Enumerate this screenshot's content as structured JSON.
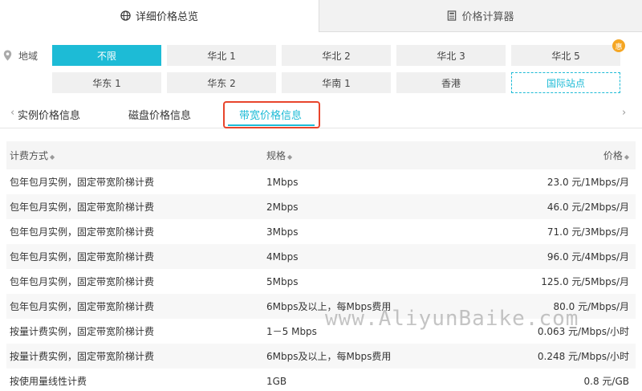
{
  "top_tabs": [
    {
      "label": "详细价格总览",
      "icon": "globe-icon",
      "active": true
    },
    {
      "label": "价格计算器",
      "icon": "calculator-icon",
      "active": false
    }
  ],
  "region": {
    "label": "地域",
    "icon": "location-pin-icon",
    "buttons_row1": [
      "不限",
      "华北 1",
      "华北 2",
      "华北 3",
      "华北 5"
    ],
    "buttons_row2": [
      "华东 1",
      "华东 2",
      "华南 1",
      "香港",
      "国际站点"
    ],
    "selected": "不限",
    "badge": "惠"
  },
  "sub_tabs": [
    "实例价格信息",
    "磁盘价格信息",
    "带宽价格信息"
  ],
  "active_sub_tab": "带宽价格信息",
  "table": {
    "headers": [
      "计费方式",
      "规格",
      "价格"
    ],
    "rows": [
      [
        "包年包月实例，固定带宽阶梯计费",
        "1Mbps",
        "23.0 元/1Mbps/月"
      ],
      [
        "包年包月实例，固定带宽阶梯计费",
        "2Mbps",
        "46.0 元/2Mbps/月"
      ],
      [
        "包年包月实例，固定带宽阶梯计费",
        "3Mbps",
        "71.0 元/3Mbps/月"
      ],
      [
        "包年包月实例，固定带宽阶梯计费",
        "4Mbps",
        "96.0 元/4Mbps/月"
      ],
      [
        "包年包月实例，固定带宽阶梯计费",
        "5Mbps",
        "125.0 元/5Mbps/月"
      ],
      [
        "包年包月实例，固定带宽阶梯计费",
        "6Mbps及以上，每Mbps费用",
        "80.0 元/Mbps/月"
      ],
      [
        "按量计费实例，固定带宽阶梯计费",
        "1－5 Mbps",
        "0.063 元/Mbps/小时"
      ],
      [
        "按量计费实例，固定带宽阶梯计费",
        "6Mbps及以上，每Mbps费用",
        "0.248 元/Mbps/小时"
      ],
      [
        "按使用量线性计费",
        "1GB",
        "0.8 元/GB"
      ]
    ]
  },
  "watermark": "www.AliyunBaike.com",
  "colors": {
    "accent": "#1dbbd6",
    "highlight": "#e8452c",
    "badge": "#f5a623"
  }
}
